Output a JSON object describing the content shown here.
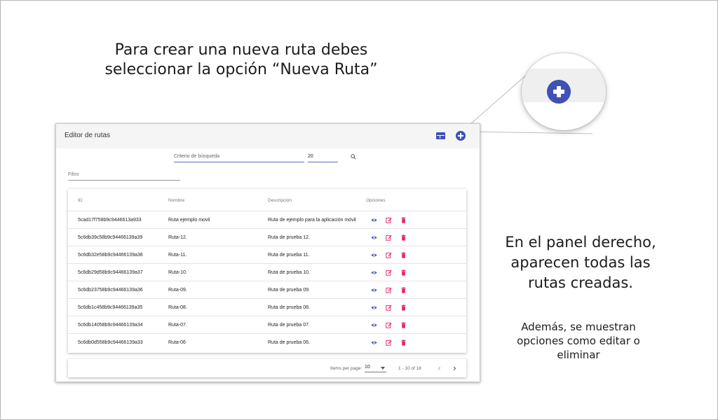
{
  "captions": {
    "top_line1": "Para crear una nueva ruta debes",
    "top_line2": "seleccionar la opción “Nueva Ruta”",
    "right_line1": "En el panel derecho,",
    "right_line2": "aparecen todas las",
    "right_line3": "rutas creadas.",
    "small_line1": "Además, se muestran",
    "small_line2": "opciones como editar o",
    "small_line3": "eliminar"
  },
  "icons": {
    "zoom": "add-circle-icon",
    "toolbar": [
      "grid-view-icon",
      "add-circle-icon"
    ],
    "search": "search-icon",
    "row_actions": [
      "eye-icon",
      "edit-icon",
      "trash-icon"
    ],
    "pager": [
      "chevron-left-icon",
      "chevron-right-icon"
    ]
  },
  "colors": {
    "primary": "#3f51b5",
    "danger": "#e91e63",
    "header_bg": "#f5f5f5"
  },
  "panel": {
    "title": "Editor de rutas",
    "search_placeholder": "Criterio de búsqueda",
    "count_value": "20",
    "filter_placeholder": "Filtro"
  },
  "table": {
    "headers": {
      "id": "ID",
      "name": "Nombre",
      "description": "Descripción",
      "options": "Opciones"
    },
    "rows": [
      {
        "id": "5cad17f758b9c9446613a933",
        "name": "Ruta ejemplo movil",
        "description": "Ruta de ejemplo para la aplicación móvil"
      },
      {
        "id": "5c6db39c58b9c94466139a39",
        "name": "Ruta-12.",
        "description": "Ruta de prueba 12."
      },
      {
        "id": "5c6db32e58b9c94466139a38",
        "name": "Ruta-11.",
        "description": "Ruta de prueba 11."
      },
      {
        "id": "5c6db29d58b9c94466139a37",
        "name": "Ruta-10.",
        "description": "Ruta de prueba 10."
      },
      {
        "id": "5c6db23758b9c94466139a36",
        "name": "Ruta-09.",
        "description": "Ruta de prueba 09."
      },
      {
        "id": "5c6db1c458b9c94466139a35",
        "name": "Ruta-08.",
        "description": "Ruta de prueba 08."
      },
      {
        "id": "5c6db14058b9c94466139a34",
        "name": "Ruta-07.",
        "description": "Ruta de prueba 07."
      },
      {
        "id": "5c6db0d558b9c94466139a33",
        "name": "Ruta-06",
        "description": "Ruta de prueba 06."
      }
    ]
  },
  "paginator": {
    "label": "Items per page:",
    "page_size": "10",
    "range": "1 - 10 of 18"
  }
}
